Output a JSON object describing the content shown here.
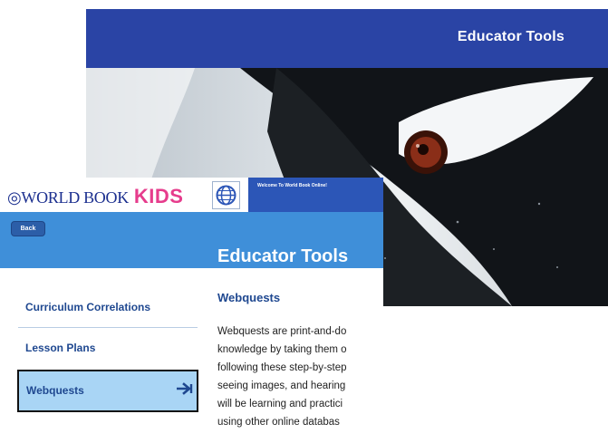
{
  "background_window": {
    "title": "Educator Tools",
    "header_color": "#2a44a5",
    "image": "penguin-photo"
  },
  "front_window": {
    "logo": {
      "world": "WORLD BOOK",
      "kids": "KIDS"
    },
    "globe_icon": "world-book-globe-icon",
    "welcome": "Welcome To World Book Online!",
    "back_button": "Back",
    "page_title": "Educator Tools",
    "sidebar": {
      "items": [
        {
          "label": "Curriculum Correlations"
        },
        {
          "label": "Lesson Plans"
        },
        {
          "label": "Webquests",
          "icon": "arrow-right-icon"
        }
      ]
    },
    "content": {
      "title": "Webquests",
      "lines": [
        "Webquests are print-and-do",
        "knowledge by taking them o",
        "following these step-by-step",
        "seeing images, and hearing",
        "will be learning and practici",
        "using other online databas"
      ]
    },
    "colors": {
      "blue_bar": "#3f8fd9",
      "accent_text": "#1f4890",
      "selected_bg": "#a9d5f5",
      "kids_pink": "#e63c8c"
    }
  }
}
